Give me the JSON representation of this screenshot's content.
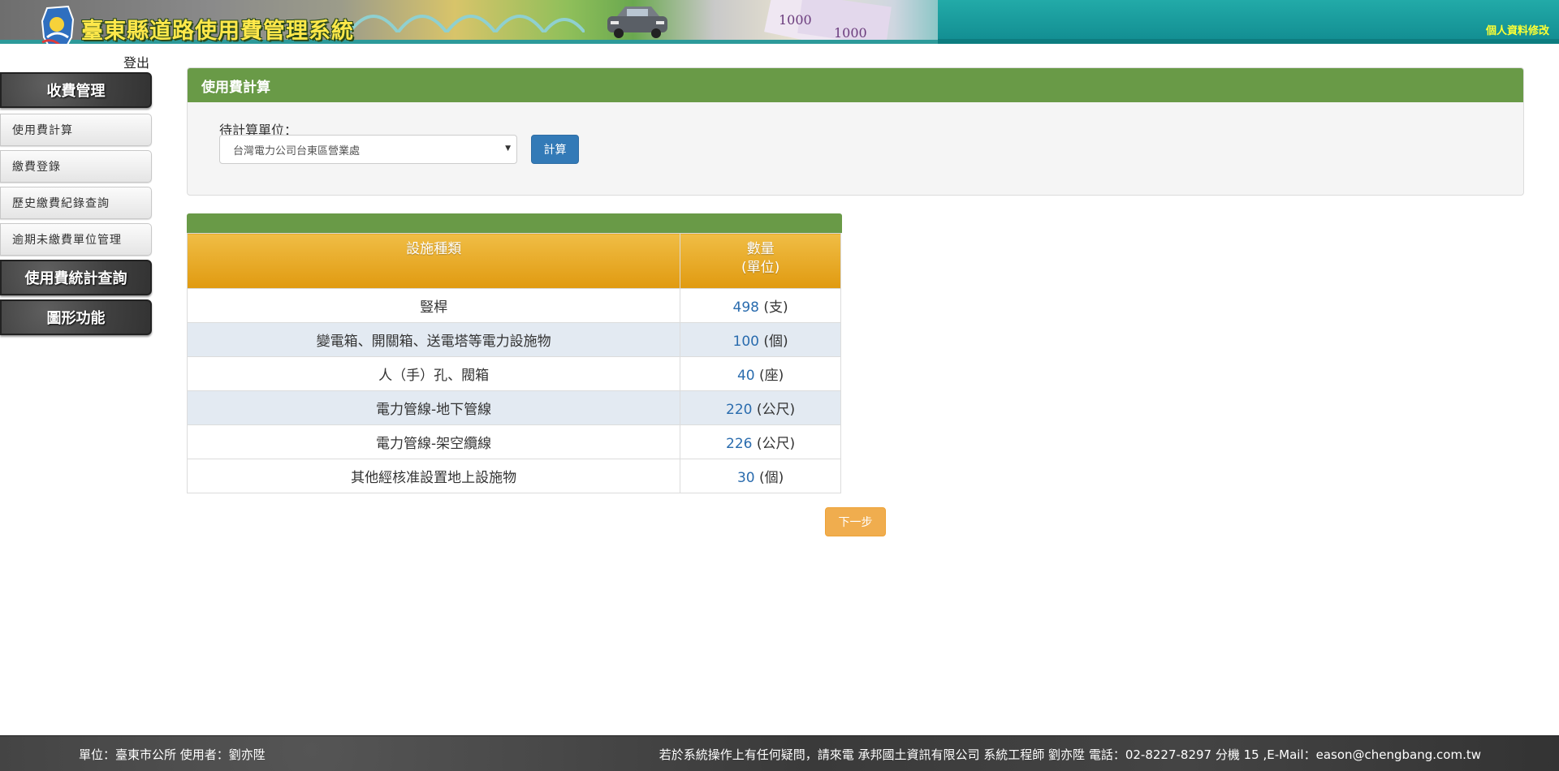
{
  "header": {
    "system_title": "臺東縣道路使用費管理系統",
    "profile_link": "個人資料修改",
    "title_color": "#ffe84a",
    "link_color": "#ffff33"
  },
  "sidebar": {
    "logout": "登出",
    "sections": [
      {
        "label": "收費管理"
      },
      {
        "label": "使用費統計查詢"
      },
      {
        "label": "圖形功能"
      }
    ],
    "items": [
      {
        "label": "使用費計算"
      },
      {
        "label": "繳費登錄"
      },
      {
        "label": "歷史繳費紀錄查詢"
      },
      {
        "label": "逾期未繳費單位管理"
      }
    ]
  },
  "panel": {
    "heading": "使用費計算",
    "field_label": "待計算單位：",
    "selected_unit": "台灣電力公司台東區營業處",
    "calc_button": "計算",
    "heading_color": "#699a47"
  },
  "table": {
    "headers": {
      "type": "設施種類",
      "qty": "數量",
      "qty_unit": "(單位)"
    },
    "rows": [
      {
        "type": "豎桿",
        "qty": "498",
        "unit": "(支)"
      },
      {
        "type": "變電箱、開關箱、送電塔等電力設施物",
        "qty": "100",
        "unit": "(個)"
      },
      {
        "type": "人（手）孔、閥箱",
        "qty": "40",
        "unit": "(座)"
      },
      {
        "type": "電力管線-地下管線",
        "qty": "220",
        "unit": "(公尺)"
      },
      {
        "type": "電力管線-架空纜線",
        "qty": "226",
        "unit": "(公尺)"
      },
      {
        "type": "其他經核准設置地上設施物",
        "qty": "30",
        "unit": "(個)"
      }
    ]
  },
  "next_button": "下一步",
  "footer": {
    "left": "單位：臺東市公所 使用者：劉亦陞",
    "right": "若於系統操作上有任何疑問，請來電 承邦國土資訊有限公司 系統工程師 劉亦陞 電話：02-8227-8297 分機 15 ,E-Mail：eason@chengbang.com.tw"
  }
}
